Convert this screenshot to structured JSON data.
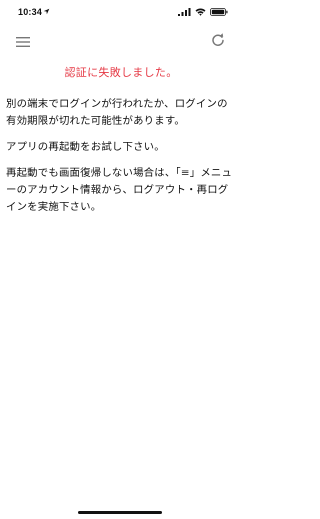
{
  "status_bar": {
    "time": "10:34",
    "location_icon": "location-arrow-icon",
    "signal_icon": "cellular-signal-icon",
    "wifi_icon": "wifi-icon",
    "battery_icon": "battery-icon"
  },
  "toolbar": {
    "menu_icon": "hamburger-menu-icon",
    "reload_icon": "reload-icon"
  },
  "error": {
    "title": "認証に失敗しました。",
    "title_color": "#e53945"
  },
  "messages": [
    "別の端末でログインが行われたか、ログインの有効期限が切れた可能性があります。",
    "アプリの再起動をお試し下さい。",
    "再起動でも画面復帰しない場合は、「≡」メニューのアカウント情報から、ログアウト・再ログインを実施下さい。"
  ]
}
